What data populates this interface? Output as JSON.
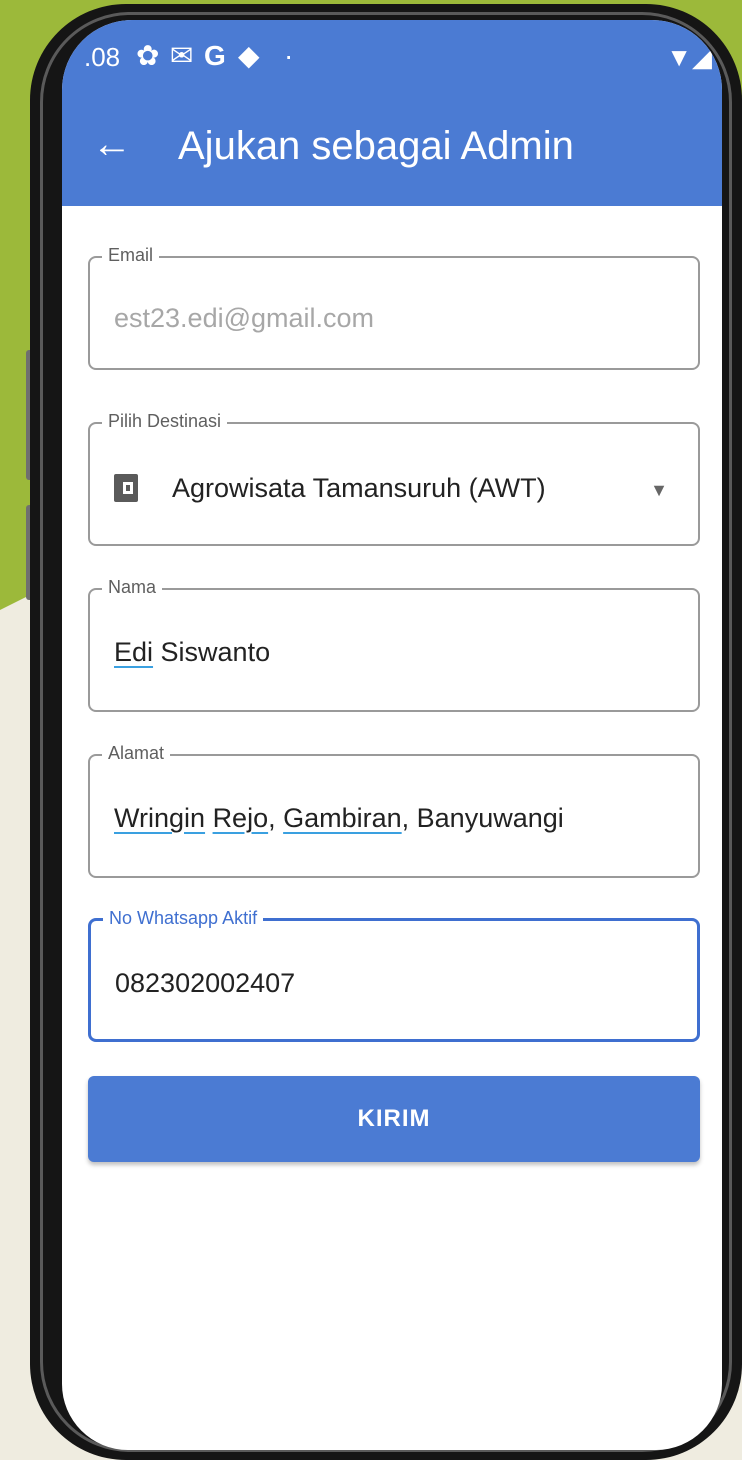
{
  "status_bar": {
    "time": ".08",
    "icons": [
      "settings-icon",
      "gmail-icon",
      "google-icon",
      "shield-icon",
      "dot-icon"
    ],
    "right_icons": [
      "wifi-icon",
      "signal-icon"
    ]
  },
  "appbar": {
    "back_icon": "arrow-left-icon",
    "title": "Ajukan sebagai Admin"
  },
  "form": {
    "email": {
      "label": "Email",
      "value": "est23.edi@gmail.com"
    },
    "destinasi": {
      "label": "Pilih Destinasi",
      "value": "Agrowisata Tamansuruh (AWT)",
      "icon": "wallet-icon"
    },
    "nama": {
      "label": "Nama",
      "value_parts": [
        "Edi",
        " Siswanto"
      ]
    },
    "alamat": {
      "label": "Alamat",
      "value_parts": [
        "Wringin",
        " ",
        "Rejo",
        ", ",
        "Gambiran",
        ", Banyuwangi"
      ]
    },
    "whatsapp": {
      "label": "No Whatsapp Aktif",
      "value": "082302002407"
    }
  },
  "submit": {
    "label": "KIRIM"
  },
  "colors": {
    "primary": "#4b7bd3",
    "background_green": "#9cb93a",
    "background_cream": "#efece0"
  }
}
